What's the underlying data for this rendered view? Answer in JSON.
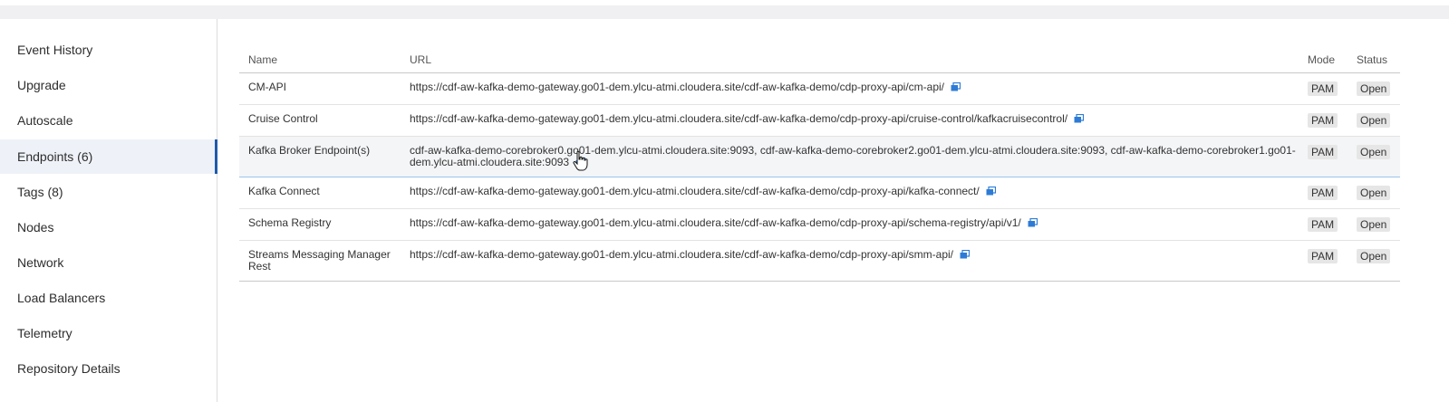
{
  "sidebar": {
    "items": [
      {
        "label": "Event History"
      },
      {
        "label": "Upgrade"
      },
      {
        "label": "Autoscale"
      },
      {
        "label": "Endpoints (6)",
        "active": true
      },
      {
        "label": "Tags (8)"
      },
      {
        "label": "Nodes"
      },
      {
        "label": "Network"
      },
      {
        "label": "Load Balancers"
      },
      {
        "label": "Telemetry"
      },
      {
        "label": "Repository Details"
      }
    ]
  },
  "table": {
    "headers": {
      "name": "Name",
      "url": "URL",
      "mode": "Mode",
      "status": "Status"
    },
    "rows": [
      {
        "name": "CM-API",
        "url": "https://cdf-aw-kafka-demo-gateway.go01-dem.ylcu-atmi.cloudera.site/cdf-aw-kafka-demo/cdp-proxy-api/cm-api/",
        "mode": "PAM",
        "status": "Open"
      },
      {
        "name": "Cruise Control",
        "url": "https://cdf-aw-kafka-demo-gateway.go01-dem.ylcu-atmi.cloudera.site/cdf-aw-kafka-demo/cdp-proxy-api/cruise-control/kafkacruisecontrol/",
        "mode": "PAM",
        "status": "Open"
      },
      {
        "name": "Kafka Broker Endpoint(s)",
        "url": "cdf-aw-kafka-demo-corebroker0.go01-dem.ylcu-atmi.cloudera.site:9093, cdf-aw-kafka-demo-corebroker2.go01-dem.ylcu-atmi.cloudera.site:9093, cdf-aw-kafka-demo-corebroker1.go01-dem.ylcu-atmi.cloudera.site:9093",
        "mode": "PAM",
        "status": "Open"
      },
      {
        "name": "Kafka Connect",
        "url": "https://cdf-aw-kafka-demo-gateway.go01-dem.ylcu-atmi.cloudera.site/cdf-aw-kafka-demo/cdp-proxy-api/kafka-connect/",
        "mode": "PAM",
        "status": "Open"
      },
      {
        "name": "Schema Registry",
        "url": "https://cdf-aw-kafka-demo-gateway.go01-dem.ylcu-atmi.cloudera.site/cdf-aw-kafka-demo/cdp-proxy-api/schema-registry/api/v1/",
        "mode": "PAM",
        "status": "Open"
      },
      {
        "name": "Streams Messaging Manager Rest",
        "url": "https://cdf-aw-kafka-demo-gateway.go01-dem.ylcu-atmi.cloudera.site/cdf-aw-kafka-demo/cdp-proxy-api/smm-api/",
        "mode": "PAM",
        "status": "Open"
      }
    ]
  },
  "icons": {
    "copy": "copy-icon",
    "cursor": "hand-pointer-cursor"
  },
  "colors": {
    "accent": "#1f5aa8",
    "copy_icon": "#2d7bd6",
    "active_bg": "#eef2f8"
  }
}
